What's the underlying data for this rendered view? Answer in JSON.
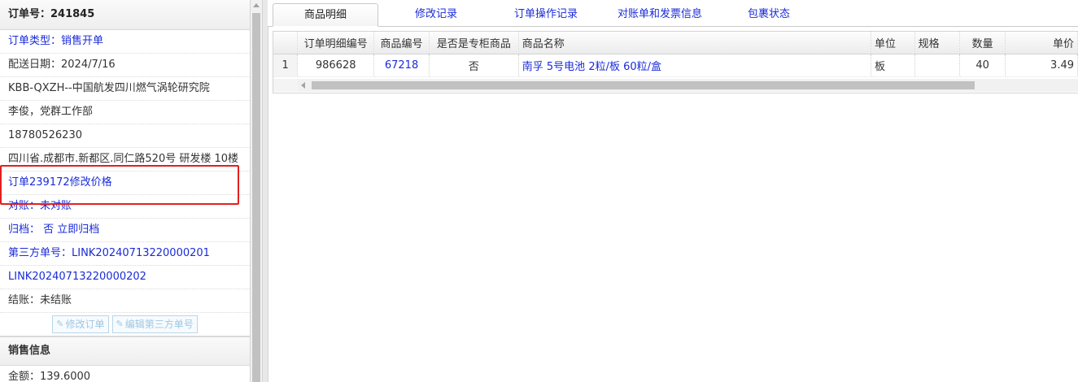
{
  "order": {
    "title": "订单号：241845",
    "rows": [
      {
        "text": "订单类型：销售开单",
        "color": "blue"
      },
      {
        "text": "配送日期：2024/7/16",
        "color": "dark"
      },
      {
        "text": "KBB-QXZH--中国航发四川燃气涡轮研究院",
        "color": "dark"
      },
      {
        "text": "李俊，党群工作部",
        "color": "dark"
      },
      {
        "text": "18780526230",
        "color": "dark"
      },
      {
        "text": "四川省.成都市.新都区.同仁路520号 研发楼 10楼",
        "color": "dark"
      },
      {
        "text": "订单239172修改价格",
        "color": "blue"
      },
      {
        "text": "对账：未对账",
        "color": "blue"
      },
      {
        "text": "归档：  否 立即归档",
        "color": "blue"
      },
      {
        "text": "第三方单号：LINK20240713220000201",
        "color": "blue"
      },
      {
        "text": "LINK20240713220000202",
        "color": "blue"
      },
      {
        "text": "结账：未结账",
        "color": "dark"
      }
    ],
    "buttons": {
      "edit_order": "修改订单",
      "edit_third_party": "编辑第三方单号"
    },
    "sales_section": "销售信息",
    "amount": "金额：139.6000"
  },
  "tabs": [
    "商品明细",
    "修改记录",
    "订单操作记录",
    "对账单和发票信息",
    "包裹状态"
  ],
  "table": {
    "headers": [
      "订单明细编号",
      "商品编号",
      "是否是专柜商品",
      "商品名称",
      "单位",
      "规格",
      "数量",
      "单价"
    ],
    "rows": [
      {
        "num": "1",
        "detail_id": "986628",
        "product_id": "67218",
        "counter": "否",
        "name": "南孚 5号电池 2粒/板 60粒/盒",
        "unit": "板",
        "spec": "",
        "qty": "40",
        "price": "3.49"
      }
    ]
  },
  "colors": {
    "link": "#1a2bd9",
    "highlight_box": "#e02020"
  }
}
